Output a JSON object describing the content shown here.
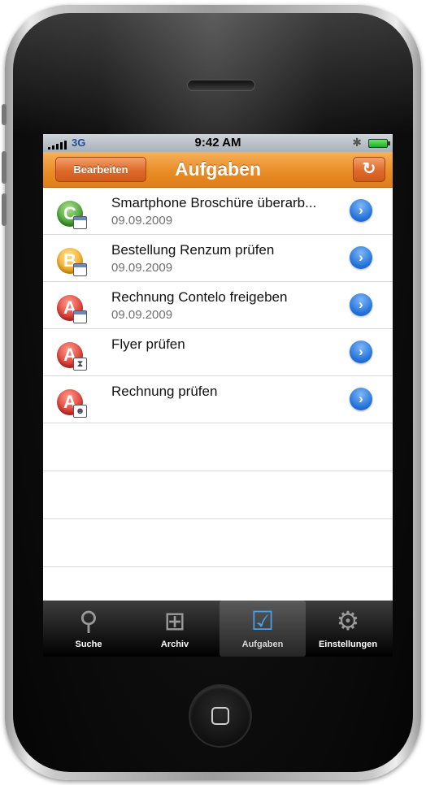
{
  "status": {
    "network": "3G",
    "time": "9:42 AM",
    "bluetooth_icon": "bluetooth-icon",
    "battery_icon": "battery-icon"
  },
  "navbar": {
    "title": "Aufgaben",
    "edit_label": "Bearbeiten",
    "refresh_icon": "↻"
  },
  "tasks": [
    {
      "priority": "C",
      "color": "green",
      "badge": "calendar",
      "title": "Smartphone Broschüre überarb...",
      "date": "09.09.2009"
    },
    {
      "priority": "B",
      "color": "yellow",
      "badge": "calendar",
      "title": "Bestellung Renzum prüfen",
      "date": "09.09.2009"
    },
    {
      "priority": "A",
      "color": "red",
      "badge": "calendar",
      "title": "Rechnung Contelo freigeben",
      "date": "09.09.2009"
    },
    {
      "priority": "A",
      "color": "red",
      "badge": "hourglass",
      "title": "Flyer prüfen",
      "date": ""
    },
    {
      "priority": "A",
      "color": "red",
      "badge": "person",
      "title": "Rechnung prüfen",
      "date": ""
    }
  ],
  "disclosure_glyph": "›",
  "tabs": [
    {
      "label": "Suche",
      "icon": "search-icon",
      "glyph": "⚲"
    },
    {
      "label": "Archiv",
      "icon": "archive-icon",
      "glyph": "⊞"
    },
    {
      "label": "Aufgaben",
      "icon": "task-list-icon",
      "glyph": "☑"
    },
    {
      "label": "Einstellungen",
      "icon": "gear-icon",
      "glyph": "⚙"
    }
  ],
  "active_tab": "Aufgaben",
  "colors": {
    "navbar": "#e88d27",
    "disclosure": "#1f6fd9",
    "priority_green": "#3f9a2c",
    "priority_yellow": "#f1a51c",
    "priority_red": "#d8322a"
  }
}
